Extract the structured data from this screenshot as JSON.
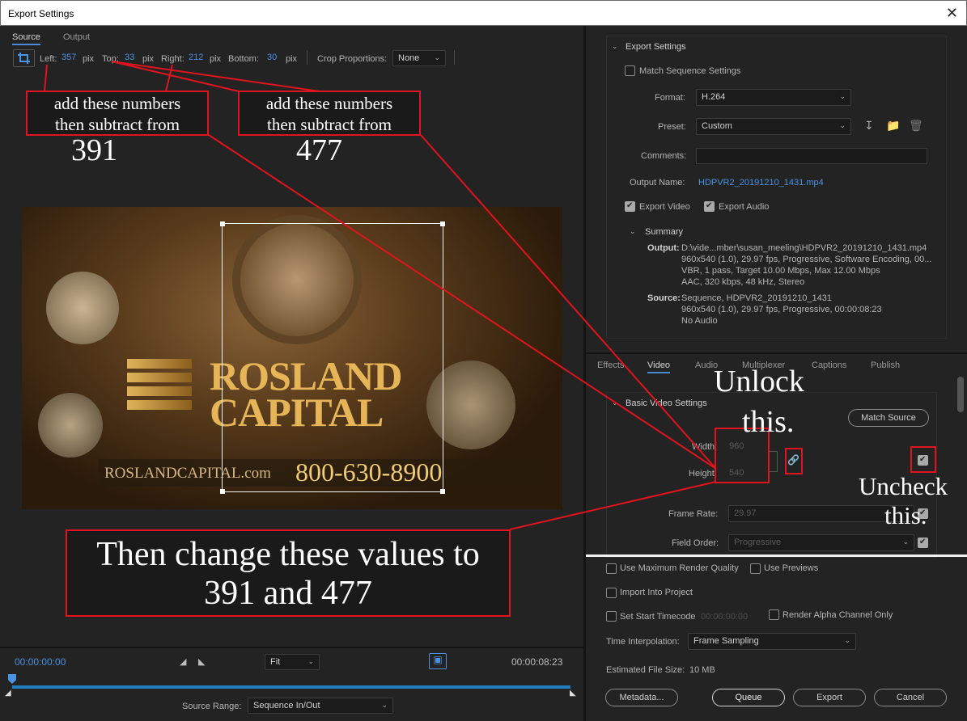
{
  "window": {
    "title": "Export Settings",
    "close": "✕"
  },
  "left_tabs": {
    "source": "Source",
    "output": "Output"
  },
  "crop_bar": {
    "left_label": "Left:",
    "left_value": "357",
    "left_unit": "pix",
    "top_label": "Top:",
    "top_value": "33",
    "top_unit": "pix",
    "right_label": "Right:",
    "right_value": "212",
    "right_unit": "pix",
    "bottom_label": "Bottom:",
    "bottom_value": "30",
    "bottom_unit": "pix",
    "proportions_label": "Crop Proportions:",
    "proportions_value": "None"
  },
  "annotations": {
    "box1_line1": "add these numbers",
    "box1_line2": "then subtract from",
    "box1_target": "391",
    "box2_line1": "add these numbers",
    "box2_line2": "then subtract from",
    "box2_target": "477",
    "unlock_line1": "Unlock",
    "unlock_line2": "this.",
    "uncheck_line1": "Uncheck",
    "uncheck_line2": "this.",
    "change_line1": "Then change these values to",
    "change_line2": "391 and 477"
  },
  "preview": {
    "brand_line1": "ROSLAND",
    "brand_line2": "CAPITAL",
    "website": "ROSLANDCAPITAL.com",
    "phone": "800-630-8900"
  },
  "timeline": {
    "start_time": "00:00:00:00",
    "end_time": "00:00:08:23",
    "zoom_value": "Fit",
    "source_range_label": "Source Range:",
    "source_range_value": "Sequence In/Out"
  },
  "export_settings": {
    "header": "Export Settings",
    "match_sequence": "Match Sequence Settings",
    "format_label": "Format:",
    "format_value": "H.264",
    "preset_label": "Preset:",
    "preset_value": "Custom",
    "comments_label": "Comments:",
    "output_name_label": "Output Name:",
    "output_name_value": "HDPVR2_20191210_1431.mp4",
    "export_video": "Export Video",
    "export_audio": "Export Audio"
  },
  "summary": {
    "header": "Summary",
    "output_label": "Output:",
    "output_lines": [
      "D:\\vide...mber\\susan_meeling\\HDPVR2_20191210_1431.mp4",
      "960x540 (1.0), 29.97 fps, Progressive, Software Encoding, 00...",
      "VBR, 1 pass, Target 10.00 Mbps, Max 12.00 Mbps",
      "AAC, 320 kbps, 48 kHz, Stereo"
    ],
    "source_label": "Source:",
    "source_lines": [
      "Sequence, HDPVR2_20191210_1431",
      "960x540 (1.0), 29.97 fps, Progressive, 00:00:08:23",
      "No Audio"
    ]
  },
  "right_tabs": [
    "Effects",
    "Video",
    "Audio",
    "Multiplexer",
    "Captions",
    "Publish"
  ],
  "video_settings": {
    "header": "Basic Video Settings",
    "match_source": "Match Source",
    "width_label": "Width:",
    "width_value": "960",
    "height_label": "Height:",
    "height_value": "540",
    "frame_rate_label": "Frame Rate:",
    "frame_rate_value": "29.97",
    "field_order_label": "Field Order:",
    "field_order_value": "Progressive"
  },
  "bottom": {
    "max_render": "Use Maximum Render Quality",
    "use_previews": "Use Previews",
    "import_project": "Import Into Project",
    "set_start_tc": "Set Start Timecode",
    "start_tc_value": "00:00:00:00",
    "render_alpha": "Render Alpha Channel Only",
    "time_interp_label": "Time Interpolation:",
    "time_interp_value": "Frame Sampling",
    "est_size_label": "Estimated File Size:",
    "est_size_value": "10 MB",
    "metadata": "Metadata...",
    "queue": "Queue",
    "export": "Export",
    "cancel": "Cancel"
  }
}
